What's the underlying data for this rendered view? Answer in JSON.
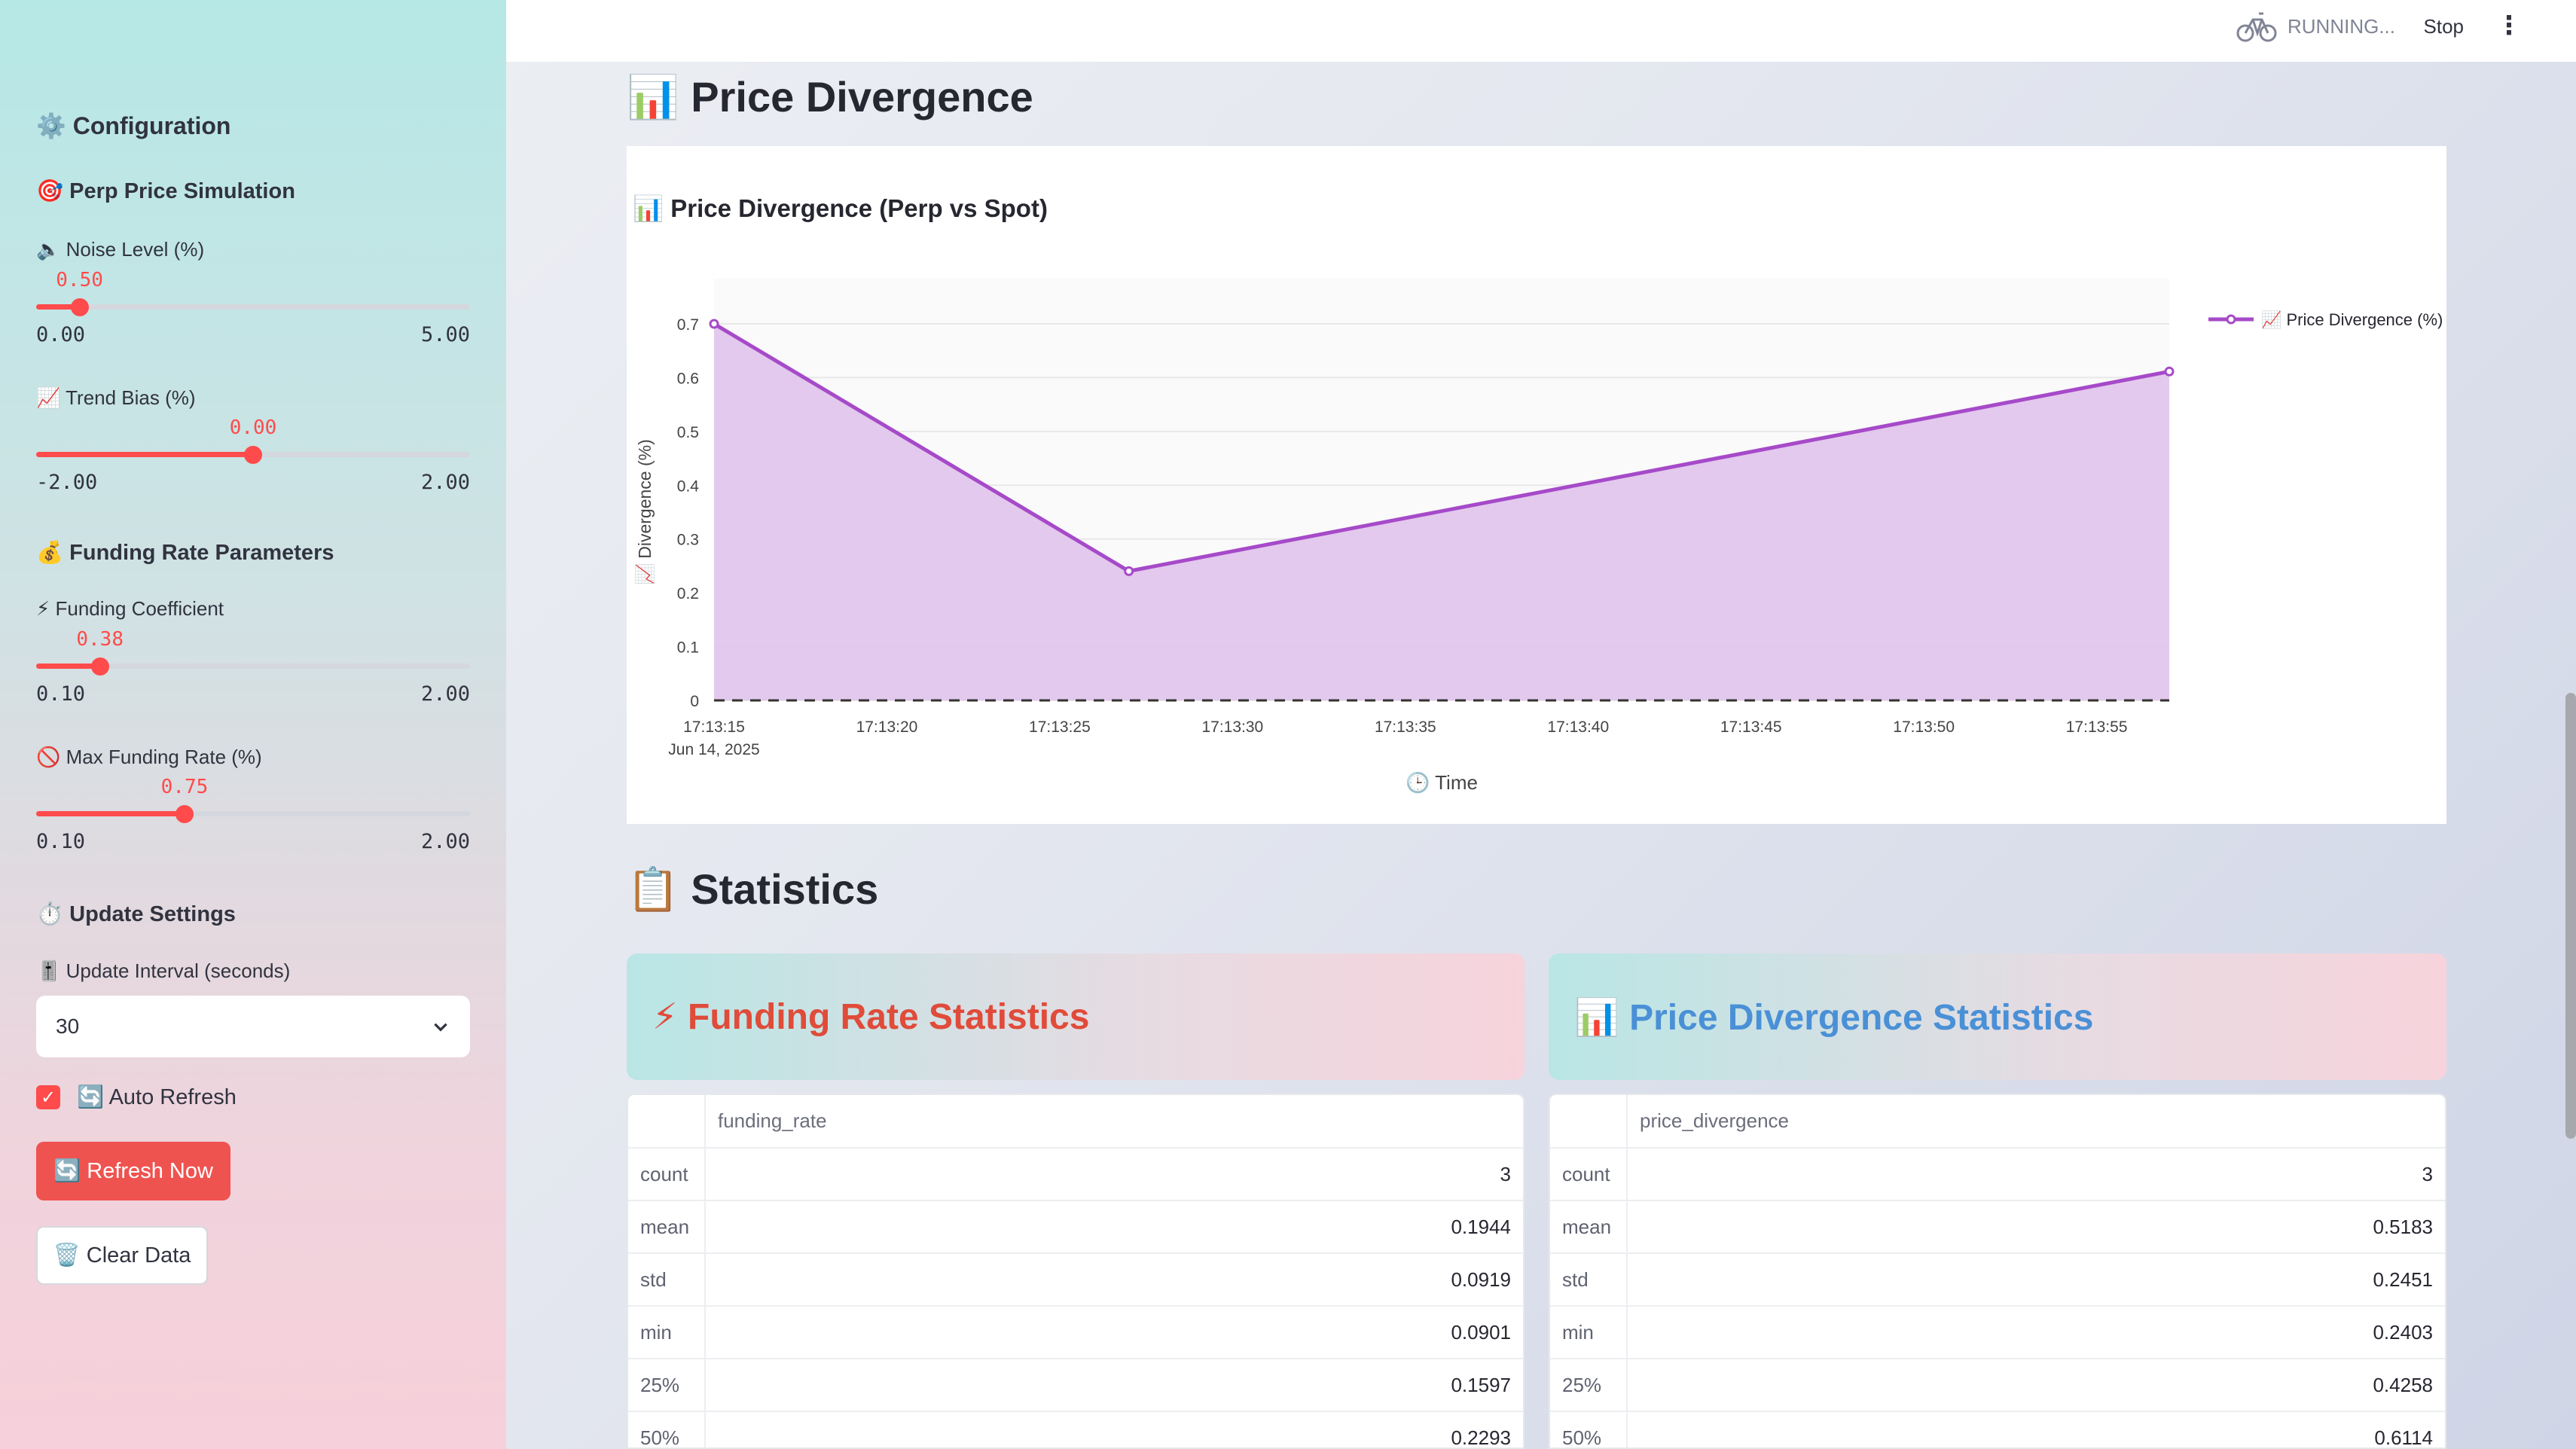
{
  "sidebar": {
    "title": "⚙️ Configuration",
    "perp_section": "🎯 Perp Price Simulation",
    "noise": {
      "label": "🔈 Noise Level (%)",
      "value": "0.50",
      "min": "0.00",
      "max": "5.00",
      "fraction": 0.1
    },
    "trend": {
      "label": "📈 Trend Bias (%)",
      "value": "0.00",
      "min": "-2.00",
      "max": "2.00",
      "fraction": 0.5
    },
    "funding_section": "💰 Funding Rate Parameters",
    "coef": {
      "label": "⚡ Funding Coefficient",
      "value": "0.38",
      "min": "0.10",
      "max": "2.00",
      "fraction": 0.147
    },
    "maxrate": {
      "label": "🚫 Max Funding Rate (%)",
      "value": "0.75",
      "min": "0.10",
      "max": "2.00",
      "fraction": 0.342
    },
    "update_section": "⏱️ Update Settings",
    "interval": {
      "label": "🎚️ Update Interval (seconds)",
      "value": "30"
    },
    "auto_refresh_label": "🔄 Auto Refresh",
    "refresh_button": "🔄 Refresh Now",
    "clear_button": "🗑️ Clear Data"
  },
  "header": {
    "status": "RUNNING...",
    "stop": "Stop",
    "menu": "⋮"
  },
  "sections": {
    "divergence_heading": "📊 Price Divergence",
    "statistics_heading": "📋 Statistics"
  },
  "colors": {
    "accent": "#ff4b4b",
    "series": "#a64ac9",
    "series_fill": "#e1c6ec",
    "funding_title": "#e04b3a",
    "divergence_title": "#4a90d6"
  },
  "chart_data": {
    "type": "area",
    "title": "📊 Price Divergence (Perp vs Spot)",
    "xlabel": "🕒 Time",
    "ylabel": "📈 Divergence (%)",
    "x_ticks": [
      "17:13:15",
      "17:13:20",
      "17:13:25",
      "17:13:30",
      "17:13:35",
      "17:13:40",
      "17:13:45",
      "17:13:50",
      "17:13:55"
    ],
    "x_date": "Jun 14, 2025",
    "y_ticks": [
      "0",
      "0.1",
      "0.2",
      "0.3",
      "0.4",
      "0.5",
      "0.6",
      "0.7"
    ],
    "ylim": [
      0,
      0.7
    ],
    "x_range_seconds": [
      15,
      57.1
    ],
    "series": [
      {
        "name": "📈 Price Divergence (%)",
        "x": [
          15,
          27,
          57.1
        ],
        "y": [
          0.7,
          0.2403,
          0.6114
        ]
      }
    ],
    "baseline": 0,
    "legend_position": "top-right"
  },
  "stats": {
    "funding_title": "⚡ Funding Rate Statistics",
    "divergence_title": "📊 Price Divergence Statistics",
    "funding_col": "funding_rate",
    "divergence_col": "price_divergence",
    "rows": [
      "count",
      "mean",
      "std",
      "min",
      "25%",
      "50%"
    ],
    "funding_values": [
      "3",
      "0.1944",
      "0.0919",
      "0.0901",
      "0.1597",
      "0.2293"
    ],
    "divergence_values": [
      "3",
      "0.5183",
      "0.2451",
      "0.2403",
      "0.4258",
      "0.6114"
    ]
  }
}
